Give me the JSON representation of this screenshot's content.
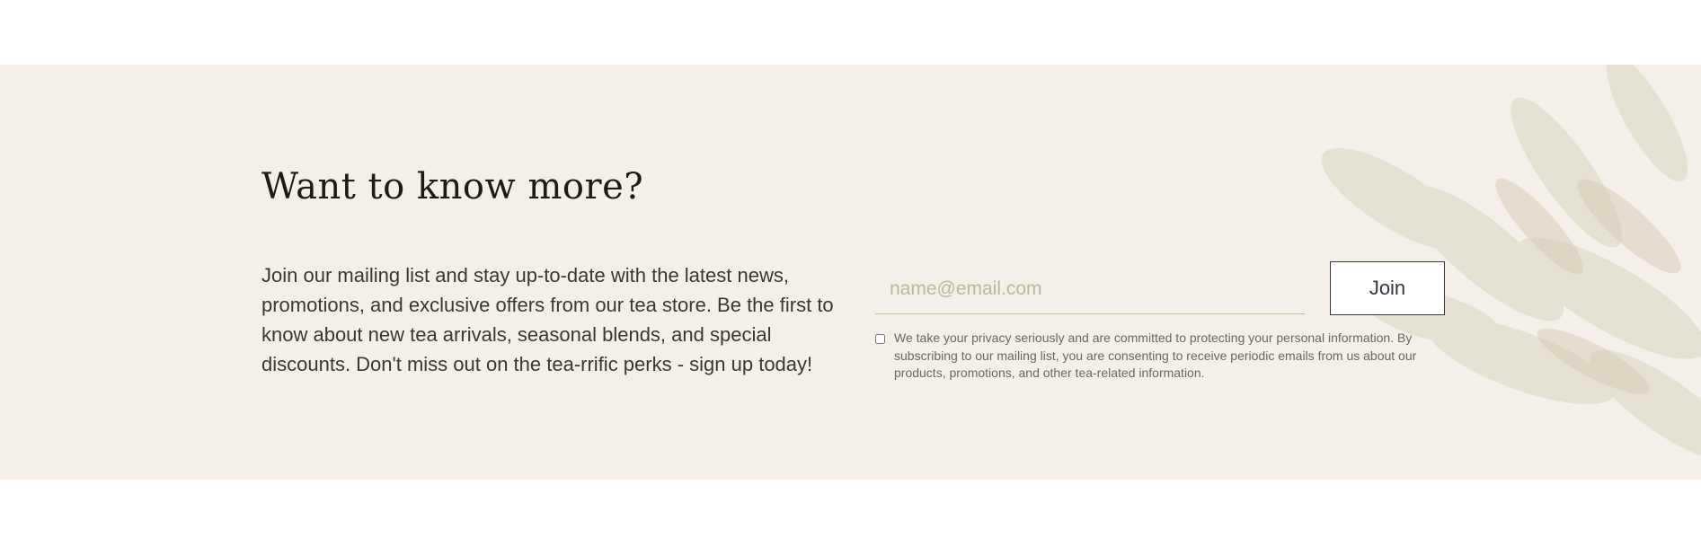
{
  "newsletter": {
    "title": "Want to know more?",
    "description": "Join our mailing list and stay up-to-date with the latest news, promotions, and exclusive offers from our tea store. Be the first to know about new tea arrivals, seasonal blends, and special discounts. Don't miss out on the tea-rrific perks - sign up today!",
    "email_placeholder": "name@email.com",
    "email_value": "",
    "join_label": "Join",
    "consent_checked": false,
    "consent_text": "We take your privacy seriously and are committed to protecting your personal information. By subscribing to our mailing list, you are consenting to receive periodic emails from us about our products, promotions, and other tea-related information.",
    "background_image": "tea-leaves-image"
  },
  "colors": {
    "band_background": "#f4f0e9",
    "input_underline": "#bdbf97",
    "placeholder": "#b9ba98",
    "text": "#3a3733"
  }
}
